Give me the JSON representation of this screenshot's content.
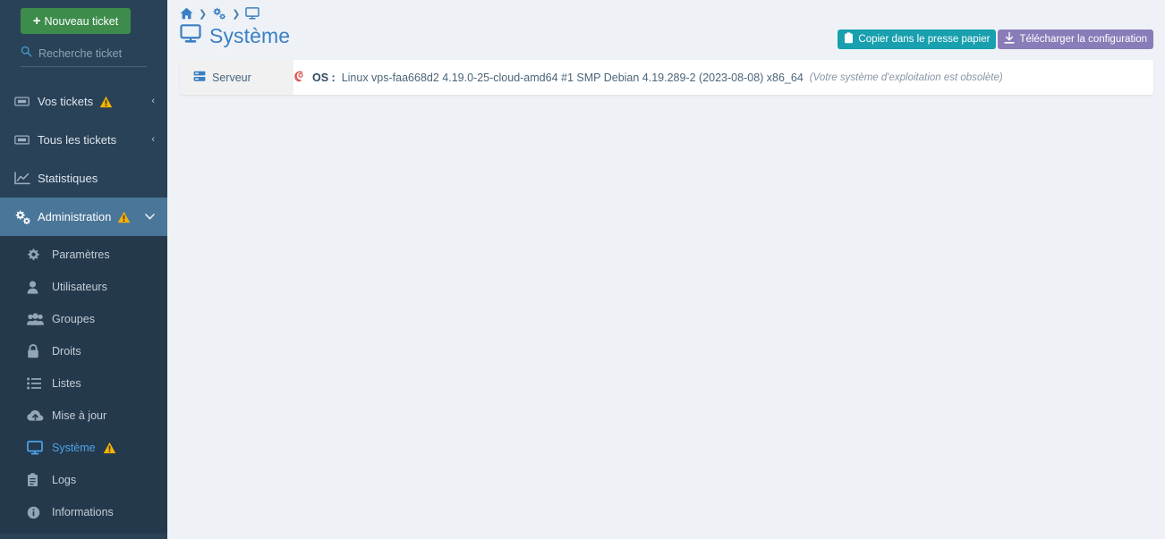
{
  "sidebar": {
    "new_ticket_button": "Nouveau ticket",
    "new_ticket_plus": "+",
    "search": {
      "placeholder": "Recherche ticket",
      "value": "",
      "icon": "search-icon"
    },
    "nav": [
      {
        "label": "Vos tickets",
        "icon": "ticket-icon",
        "warning": true,
        "chevron": "‹",
        "active": false
      },
      {
        "label": "Tous les tickets",
        "icon": "ticket-icon",
        "warning": false,
        "chevron": "‹",
        "active": false
      },
      {
        "label": "Statistiques",
        "icon": "chart-line-icon",
        "warning": false,
        "chevron": "",
        "active": false
      },
      {
        "label": "Administration",
        "icon": "cogs-icon",
        "warning": true,
        "chevron": "⌄",
        "active": true
      }
    ],
    "submenu": [
      {
        "label": "Paramètres",
        "icon": "gear-icon",
        "warning": false,
        "current": false
      },
      {
        "label": "Utilisateurs",
        "icon": "user-icon",
        "warning": false,
        "current": false
      },
      {
        "label": "Groupes",
        "icon": "users-icon",
        "warning": false,
        "current": false
      },
      {
        "label": "Droits",
        "icon": "lock-icon",
        "warning": false,
        "current": false
      },
      {
        "label": "Listes",
        "icon": "list-icon",
        "warning": false,
        "current": false
      },
      {
        "label": "Mise à jour",
        "icon": "cloud-up-icon",
        "warning": false,
        "current": false
      },
      {
        "label": "Système",
        "icon": "desktop-icon",
        "warning": true,
        "current": true
      },
      {
        "label": "Logs",
        "icon": "clipboard-icon",
        "warning": false,
        "current": false
      },
      {
        "label": "Informations",
        "icon": "info-circle-icon",
        "warning": false,
        "current": false
      }
    ]
  },
  "breadcrumb": {
    "items": [
      {
        "icon": "home-icon"
      },
      {
        "icon": "cogs-icon"
      },
      {
        "icon": "desktop-icon"
      }
    ],
    "separator": "❯"
  },
  "header": {
    "title": "Système",
    "title_icon": "desktop-icon",
    "buttons": [
      {
        "label": "Copier dans le presse papier",
        "icon": "clipboard-icon",
        "style": "teal"
      },
      {
        "label": "Télécharger la configuration",
        "icon": "download-icon",
        "style": "purple"
      }
    ]
  },
  "card": {
    "tabs": [
      {
        "label": "Serveur",
        "icon": "server-icon",
        "active": true
      }
    ],
    "os": {
      "distro_icon": "debian-icon",
      "label": "OS :",
      "value": "Linux vps-faa668d2 4.19.0-25-cloud-amd64 #1 SMP Debian 4.19.289-2 (2023-08-08) x86_64",
      "note": "(Votre système d'exploitation est obsolète)"
    }
  },
  "colors": {
    "sidebar_bg": "#2a4258",
    "submenu_bg": "#24394c",
    "active_item": "#4a7699",
    "accent_blue": "#3b7fc4",
    "current_link": "#4da3e8",
    "green": "#3d8c4c",
    "teal": "#18a0af",
    "purple": "#8a7cb8",
    "warning": "#f4b30a",
    "page_bg": "#eef2f6",
    "debian_red": "#d9534f"
  }
}
